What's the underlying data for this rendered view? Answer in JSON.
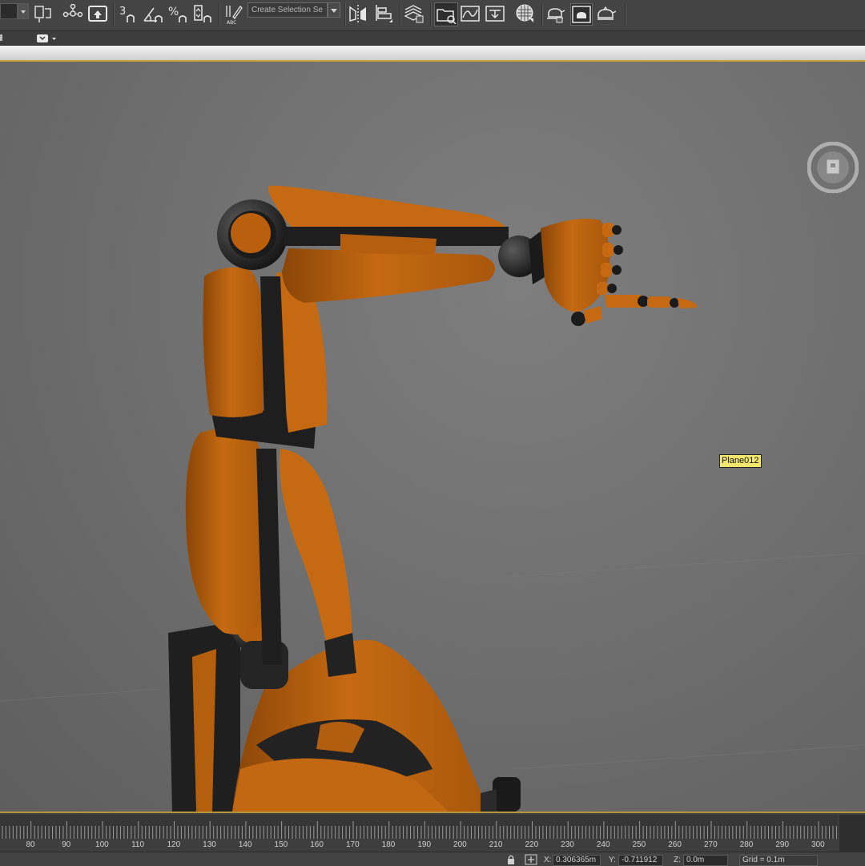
{
  "toolbar": {
    "named_selection_placeholder": "Create Selection Se",
    "icons": [
      "select-and-link-icon",
      "bind-to-space-warp-icon",
      "snap-3d-icon",
      "angle-snap-icon",
      "percent-snap-icon",
      "spinner-snap-icon",
      "edit-named-selection-icon",
      "mirror-icon",
      "align-icon",
      "layer-manager-icon",
      "scene-explorer-icon",
      "curve-editor-icon",
      "schematic-view-icon",
      "material-editor-icon",
      "render-setup-icon",
      "rendered-frame-window-icon",
      "render-icon"
    ]
  },
  "viewport": {
    "object_label": "Plane012",
    "model_color": "#c56a12",
    "joint_color": "#262626"
  },
  "timeline": {
    "ticks": [
      "80",
      "90",
      "100",
      "110",
      "120",
      "130",
      "140",
      "150",
      "160",
      "170",
      "180",
      "190",
      "200",
      "210",
      "220",
      "230",
      "240",
      "250",
      "260",
      "270",
      "280",
      "290",
      "300"
    ]
  },
  "status": {
    "x_label": "X:",
    "x_value": "0.306365m",
    "y_label": "Y:",
    "y_value": "-0.711912",
    "z_label": "Z:",
    "z_value": "0.0m",
    "grid": "Grid = 0.1m"
  }
}
